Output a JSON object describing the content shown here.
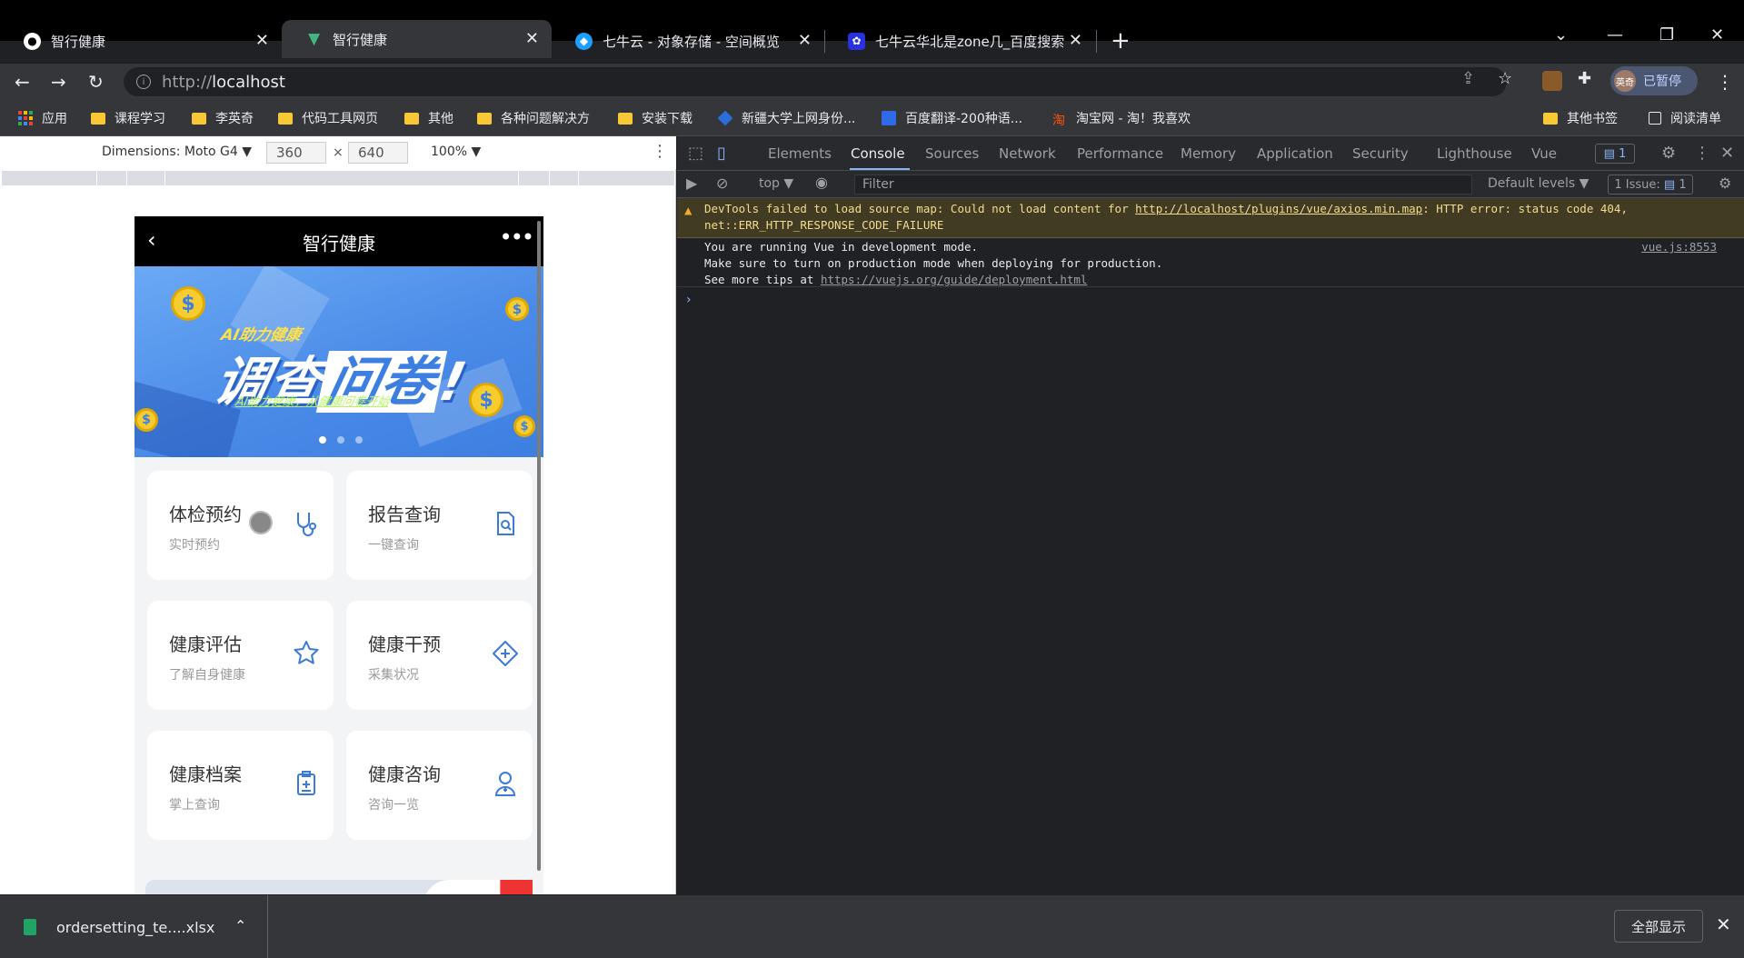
{
  "tabs": [
    {
      "title": "智行健康",
      "favicon": "github-icon",
      "active": false
    },
    {
      "title": "智行健康",
      "favicon": "vue-icon",
      "active": true
    },
    {
      "title": "七牛云 - 对象存储 - 空间概览",
      "favicon": "qiniu-icon",
      "active": false
    },
    {
      "title": "七牛云华北是zone几_百度搜索",
      "favicon": "baidu-icon",
      "active": false
    }
  ],
  "address_bar": {
    "scheme": "http://",
    "host": "localhost"
  },
  "profile": {
    "avatar_text": "英奇",
    "status": "已暂停"
  },
  "bookmarks": [
    {
      "label": "应用",
      "type": "apps"
    },
    {
      "label": "课程学习",
      "type": "folder"
    },
    {
      "label": "李英奇",
      "type": "folder"
    },
    {
      "label": "代码工具网页",
      "type": "folder"
    },
    {
      "label": "其他",
      "type": "folder"
    },
    {
      "label": "各种问题解决方",
      "type": "folder"
    },
    {
      "label": "安装下载",
      "type": "folder"
    },
    {
      "label": "新疆大学上网身份...",
      "type": "site"
    },
    {
      "label": "百度翻译-200种语...",
      "type": "site"
    },
    {
      "label": "淘宝网 - 淘！我喜欢",
      "type": "site"
    },
    {
      "label": "其他书签",
      "type": "folder"
    },
    {
      "label": "阅读清单",
      "type": "reading-list"
    }
  ],
  "device_toolbar": {
    "dimensions": "Dimensions: Moto G4 ▼",
    "width": "360",
    "height": "640",
    "times": "×",
    "zoom": "100% ▼"
  },
  "phone": {
    "back": "‹",
    "title": "智行健康",
    "more": "•••",
    "banner": {
      "tag": "AI助力健康",
      "headline_a": "调查",
      "headline_b": "问卷",
      "headline_c": "!",
      "subline": "AI助力健康，从健康问卷开始",
      "slides": 3,
      "active_slide": 0
    },
    "cards": [
      {
        "title": "体检预约",
        "subtitle": "实时预约",
        "icon": "stethoscope-icon"
      },
      {
        "title": "报告查询",
        "subtitle": "一键查询",
        "icon": "report-search-icon"
      },
      {
        "title": "健康评估",
        "subtitle": "了解自身健康",
        "icon": "star-icon"
      },
      {
        "title": "健康干预",
        "subtitle": "采集状况",
        "icon": "diamond-plus-icon"
      },
      {
        "title": "健康档案",
        "subtitle": "掌上查询",
        "icon": "clipboard-plus-icon"
      },
      {
        "title": "健康咨询",
        "subtitle": "咨询一览",
        "icon": "doctor-icon"
      }
    ]
  },
  "devtools": {
    "tabs": [
      "Elements",
      "Console",
      "Sources",
      "Network",
      "Performance",
      "Memory",
      "Application",
      "Security",
      "Lighthouse",
      "Vue"
    ],
    "active_tab": "Console",
    "message_count": "1",
    "context": "top ▼",
    "filter_placeholder": "Filter",
    "levels": "Default levels ▼",
    "issues": "1 Issue:",
    "issues_count": "1",
    "warning": {
      "prefix": "DevTools failed to load source map: Could not load content for ",
      "link": "http://localhost/plugins/vue/axios.min.map",
      "suffix": ": HTTP error: status code 404,",
      "line2": "net::ERR_HTTP_RESPONSE_CODE_FAILURE"
    },
    "log": {
      "line1": "You are running Vue in development mode.",
      "line2": "Make sure to turn on production mode when deploying for production.",
      "line3_prefix": "See more tips at ",
      "line3_link": "https://vuejs.org/guide/deployment.html",
      "source": "vue.js:8553"
    },
    "prompt": "›"
  },
  "download": {
    "filename": "ordersetting_te....xlsx",
    "show_all": "全部显示"
  }
}
